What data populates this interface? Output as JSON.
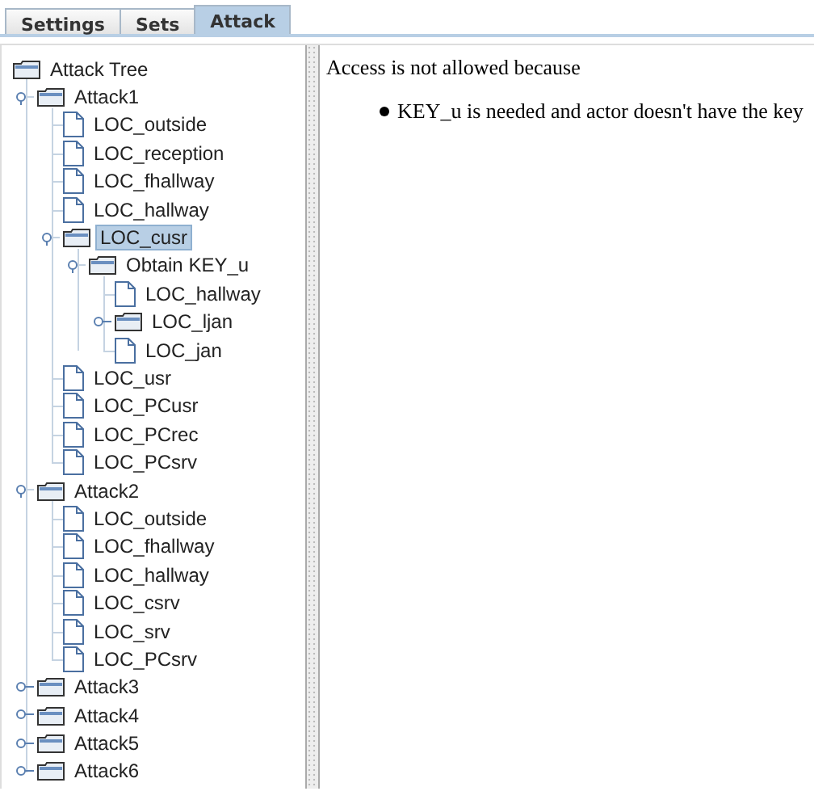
{
  "tabs": [
    {
      "label": "Settings",
      "selected": false
    },
    {
      "label": "Sets",
      "selected": false
    },
    {
      "label": "Attack",
      "selected": true
    }
  ],
  "tree": {
    "label": "Attack Tree",
    "kind": "folder",
    "selected": false,
    "children": [
      {
        "label": "Attack1",
        "kind": "folder",
        "expanded": true,
        "selected": false,
        "children": [
          {
            "label": "LOC_outside",
            "kind": "leaf",
            "selected": false
          },
          {
            "label": "LOC_reception",
            "kind": "leaf",
            "selected": false
          },
          {
            "label": "LOC_fhallway",
            "kind": "leaf",
            "selected": false
          },
          {
            "label": "LOC_hallway",
            "kind": "leaf",
            "selected": false
          },
          {
            "label": "LOC_cusr",
            "kind": "folder",
            "expanded": true,
            "selected": true,
            "children": [
              {
                "label": "Obtain KEY_u",
                "kind": "folder",
                "expanded": true,
                "selected": false,
                "children": [
                  {
                    "label": "LOC_hallway",
                    "kind": "leaf",
                    "selected": false
                  },
                  {
                    "label": "LOC_ljan",
                    "kind": "folder",
                    "expanded": false,
                    "selected": false
                  },
                  {
                    "label": "LOC_jan",
                    "kind": "leaf",
                    "selected": false
                  }
                ]
              }
            ]
          },
          {
            "label": "LOC_usr",
            "kind": "leaf",
            "selected": false
          },
          {
            "label": "LOC_PCusr",
            "kind": "leaf",
            "selected": false
          },
          {
            "label": "LOC_PCrec",
            "kind": "leaf",
            "selected": false
          },
          {
            "label": "LOC_PCsrv",
            "kind": "leaf",
            "selected": false
          }
        ]
      },
      {
        "label": "Attack2",
        "kind": "folder",
        "expanded": true,
        "selected": false,
        "children": [
          {
            "label": "LOC_outside",
            "kind": "leaf",
            "selected": false
          },
          {
            "label": "LOC_fhallway",
            "kind": "leaf",
            "selected": false
          },
          {
            "label": "LOC_hallway",
            "kind": "leaf",
            "selected": false
          },
          {
            "label": "LOC_csrv",
            "kind": "leaf",
            "selected": false
          },
          {
            "label": "LOC_srv",
            "kind": "leaf",
            "selected": false
          },
          {
            "label": "LOC_PCsrv",
            "kind": "leaf",
            "selected": false
          }
        ]
      },
      {
        "label": "Attack3",
        "kind": "folder",
        "expanded": false,
        "selected": false
      },
      {
        "label": "Attack4",
        "kind": "folder",
        "expanded": false,
        "selected": false
      },
      {
        "label": "Attack5",
        "kind": "folder",
        "expanded": false,
        "selected": false
      },
      {
        "label": "Attack6",
        "kind": "folder",
        "expanded": false,
        "selected": false
      }
    ]
  },
  "details": {
    "heading": "Access is not allowed because",
    "reasons": [
      "KEY_u is needed and actor doesn't have the key"
    ]
  }
}
